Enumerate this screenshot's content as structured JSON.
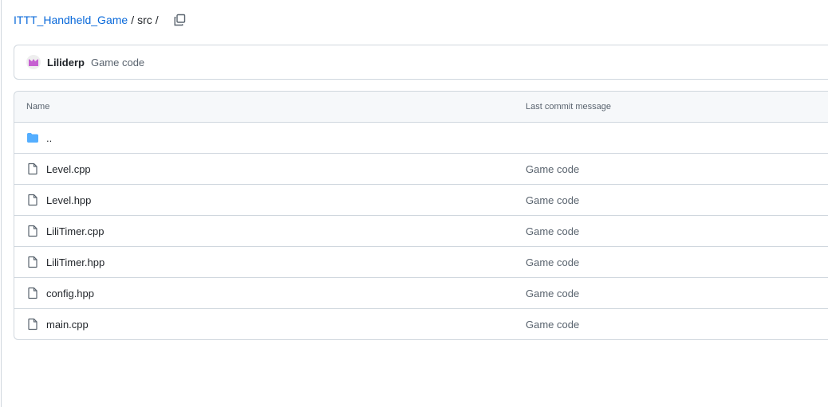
{
  "breadcrumb": {
    "repo": "ITTT_Handheld_Game",
    "sep1": "/",
    "folder": "src",
    "sep2": "/"
  },
  "commit": {
    "author": "Liliderp",
    "message": "Game code"
  },
  "table": {
    "headers": {
      "name": "Name",
      "message": "Last commit message"
    },
    "parent": "..",
    "files": [
      {
        "name": "Level.cpp",
        "message": "Game code"
      },
      {
        "name": "Level.hpp",
        "message": "Game code"
      },
      {
        "name": "LiliTimer.cpp",
        "message": "Game code"
      },
      {
        "name": "LiliTimer.hpp",
        "message": "Game code"
      },
      {
        "name": "config.hpp",
        "message": "Game code"
      },
      {
        "name": "main.cpp",
        "message": "Game code"
      }
    ]
  },
  "colors": {
    "link": "#0969da",
    "folder": "#54aeff",
    "avatar": "#c660d1"
  }
}
